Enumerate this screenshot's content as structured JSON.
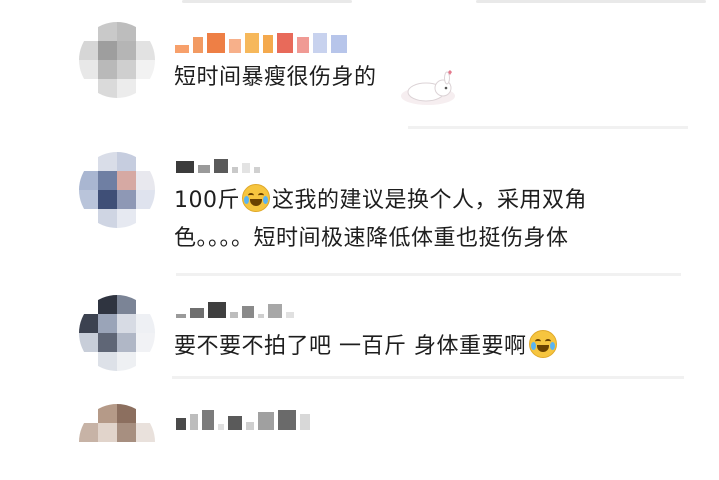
{
  "comments": [
    {
      "text_lines": [
        "短时间暴瘦很伤身的"
      ],
      "avatar_colors": [
        "#ffffff",
        "#c9c9c9",
        "#bdbdbd",
        "#ffffff",
        "#d6d6d6",
        "#9e9e9e",
        "#b5b5b5",
        "#e2e2e2",
        "#e8e8e8",
        "#b9b9b9",
        "#cfcfcf",
        "#f2f2f2",
        "#ffffff",
        "#dadada",
        "#ececec",
        "#ffffff"
      ],
      "name_colors": [
        "#f7a06b",
        "#f29a62",
        "#ee7f45",
        "#f7b08a",
        "#f6b85b",
        "#f4a94d",
        "#e86a5a",
        "#f09a94",
        "#c8d2ee",
        "#b7c5ea"
      ]
    },
    {
      "text_lines": [
        "100斤",
        "这我的建议是换个人，采用双角",
        "色。。。。短时间极速降低体重也挺伤身体"
      ],
      "avatar_colors": [
        "#ffffff",
        "#d9dde8",
        "#c6cddf",
        "#ffffff",
        "#a9b6d1",
        "#6f7fa3",
        "#d6a9a3",
        "#e8e8ee",
        "#b9c4da",
        "#3f4f77",
        "#8e98b5",
        "#dfe3ee",
        "#ffffff",
        "#cfd5e3",
        "#e6e9f1",
        "#ffffff"
      ],
      "name_colors": [
        "#3b3b3b",
        "#9a9a9a",
        "#5a5a5a",
        "#c9c9c9",
        "#e3e3e3",
        "#d0d0d0"
      ]
    },
    {
      "text_lines": [
        "要不要不拍了吧 一百斤 身体重要啊"
      ],
      "avatar_colors": [
        "#ffffff",
        "#2f3440",
        "#7b8496",
        "#ffffff",
        "#3c4250",
        "#9aa4b8",
        "#d7dbe4",
        "#eef0f4",
        "#c8ced9",
        "#5f6676",
        "#b0b7c6",
        "#f1f2f5",
        "#ffffff",
        "#dde1e8",
        "#eef0f3",
        "#ffffff"
      ],
      "name_colors": [
        "#9a9a9a",
        "#6f6f6f",
        "#3f3f3f",
        "#bdbdbd",
        "#8a8a8a",
        "#cfcfcf",
        "#a7a7a7",
        "#e0e0e0"
      ]
    },
    {
      "text_lines": [],
      "avatar_colors": [
        "#ffffff",
        "#b59a88",
        "#8c6f5f",
        "#ffffff",
        "#c7b3a6",
        "#e1d4cb",
        "#a78f80",
        "#e9e1dc"
      ],
      "name_colors": [
        "#4a4a4a",
        "#bdbdbd",
        "#7b7b7b",
        "#e0e0e0",
        "#5a5a5a",
        "#cfcfcf",
        "#a0a0a0",
        "#6a6a6a",
        "#d8d8d8"
      ]
    }
  ],
  "emoji_name": "laughing-crying-emoji",
  "sticker_name": "lying-rabbit-sticker"
}
